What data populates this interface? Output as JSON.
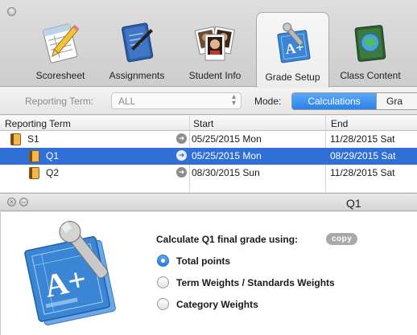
{
  "toolbar": {
    "items": [
      {
        "label": "Scoresheet",
        "icon": "scoresheet-icon"
      },
      {
        "label": "Assignments",
        "icon": "assignments-icon"
      },
      {
        "label": "Student Info",
        "icon": "student-info-icon"
      },
      {
        "label": "Grade Setup",
        "icon": "grade-setup-icon",
        "active": true
      },
      {
        "label": "Class Content",
        "icon": "class-content-icon"
      }
    ]
  },
  "filter": {
    "reporting_term_label": "Reporting Term:",
    "reporting_term_value": "ALL",
    "mode_label": "Mode:",
    "mode_options": [
      "Calculations",
      "Gra"
    ],
    "mode_selected": "Calculations"
  },
  "table": {
    "columns": [
      "Reporting Term",
      "Start",
      "End"
    ],
    "rows": [
      {
        "term": "S1",
        "start": "05/25/2015 Mon",
        "end": "11/28/2015 Sat",
        "level": 0,
        "selected": false
      },
      {
        "term": "Q1",
        "start": "05/25/2015 Mon",
        "end": "08/29/2015 Sat",
        "level": 1,
        "selected": true
      },
      {
        "term": "Q2",
        "start": "08/30/2015 Sun",
        "end": "11/28/2015 Sat",
        "level": 1,
        "selected": false
      }
    ]
  },
  "panel": {
    "title": "Q1",
    "calc_label": "Calculate Q1 final grade using:",
    "copy_label": "copy",
    "options": [
      {
        "label": "Total points",
        "selected": true
      },
      {
        "label": "Term Weights / Standards Weights",
        "selected": false
      },
      {
        "label": "Category Weights",
        "selected": false
      }
    ]
  },
  "colors": {
    "selection": "#2f6fd6",
    "segment_active": "#3b8ff0",
    "toolbar_bg": "#d6d6d6"
  }
}
